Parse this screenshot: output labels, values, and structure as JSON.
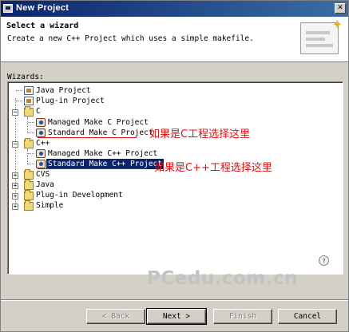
{
  "window": {
    "title": "New Project"
  },
  "header": {
    "title": "Select a wizard",
    "description": "Create a new C++ Project which uses a simple makefile."
  },
  "wizards_label": "Wizards:",
  "tree": {
    "java_project": "Java Project",
    "plugin_project": "Plug-in Project",
    "c_folder": "C",
    "managed_make_c": "Managed Make C Project",
    "standard_make_c": "Standard Make C Project",
    "cpp_folder": "C++",
    "managed_make_cpp": "Managed Make C++ Project",
    "standard_make_cpp": "Standard Make C++ Project",
    "cvs_folder": "CVS",
    "java_folder": "Java",
    "plugin_dev_folder": "Plug-in Development",
    "simple_folder": "Simple"
  },
  "annotations": {
    "c_note": "如果是C工程选择这里",
    "cpp_note": "如果是C++工程选择这里"
  },
  "watermark": "PCedu.com.cn",
  "buttons": {
    "back": "< Back",
    "next": "Next >",
    "finish": "Finish",
    "cancel": "Cancel"
  },
  "colors": {
    "selection": "#0a246a",
    "annotation": "#e01010"
  }
}
